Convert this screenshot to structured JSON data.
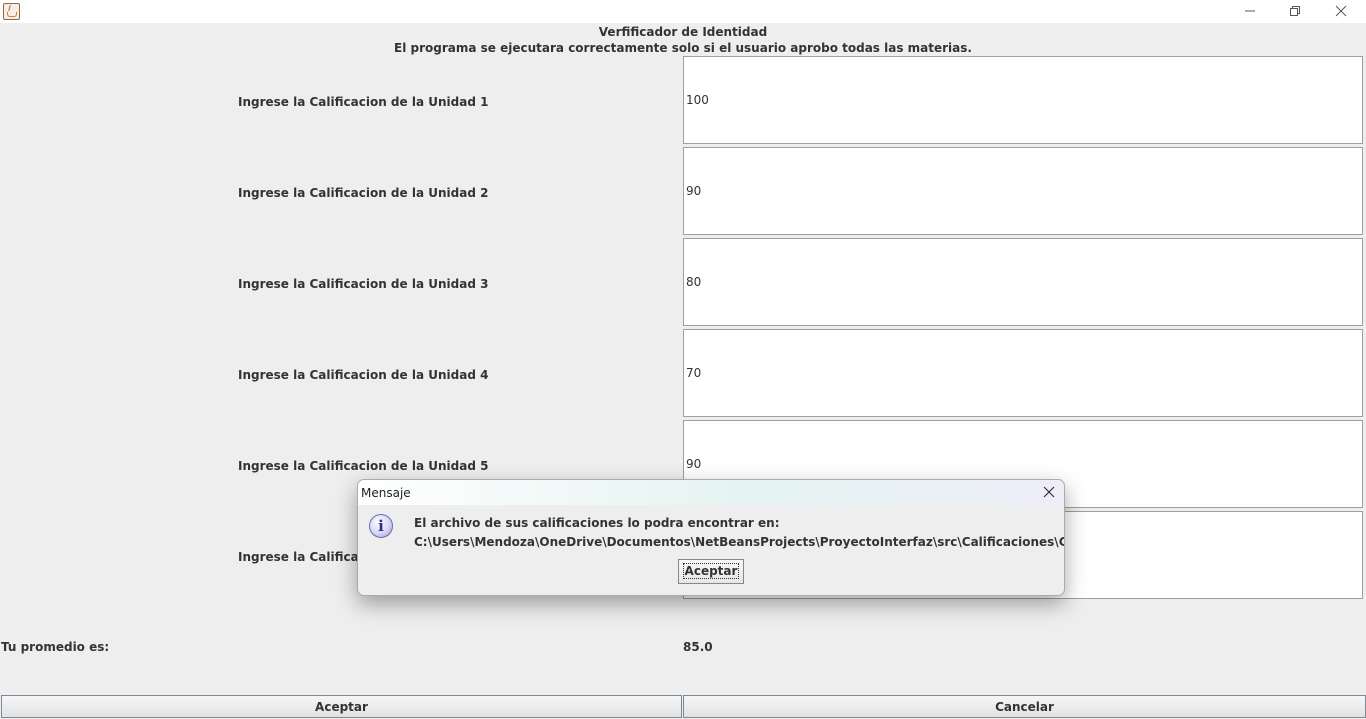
{
  "window": {
    "minimize_icon": "minimize-icon",
    "maximize_icon": "maximize-icon",
    "close_icon": "close-icon"
  },
  "header": {
    "title": "Verfificador de Identidad",
    "subtitle": "El programa se ejecutara correctamente solo si el usuario aprobo todas las materias."
  },
  "rows": [
    {
      "label": "Ingrese la Calificacion de la Unidad 1",
      "value": "100"
    },
    {
      "label": "Ingrese la Calificacion de la Unidad 2",
      "value": "90"
    },
    {
      "label": "Ingrese la Calificacion de la Unidad 3",
      "value": "80"
    },
    {
      "label": "Ingrese la Calificacion de la Unidad 4",
      "value": "70"
    },
    {
      "label": "Ingrese la Calificacion de la Unidad 5",
      "value": "90"
    },
    {
      "label": "Ingrese la Calificacio",
      "value": ""
    }
  ],
  "average": {
    "label": "Tu promedio es:",
    "value": "85.0"
  },
  "buttons": {
    "accept": "Aceptar",
    "cancel": "Cancelar"
  },
  "dialog": {
    "title": "Mensaje",
    "line1": "El archivo de sus calificaciones lo podra encontrar en:",
    "line2": "C:\\Users\\Mendoza\\OneDrive\\Documentos\\NetBeansProjects\\ProyectoInterfaz\\src\\Calificaciones\\Calificaciones.txt",
    "button": "Aceptar",
    "icon": "info-icon"
  }
}
